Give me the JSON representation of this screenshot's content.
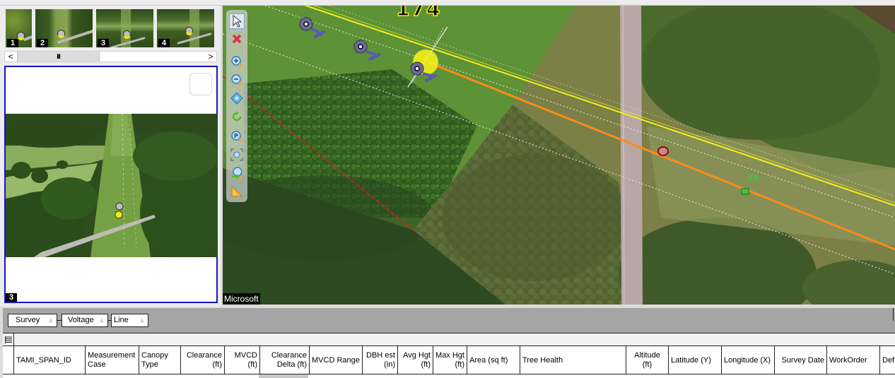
{
  "thumbnails": [
    {
      "label": "1"
    },
    {
      "label": "2"
    },
    {
      "label": "3"
    },
    {
      "label": "4"
    }
  ],
  "thumb_scroll": {
    "left_label": "<",
    "right_label": ">",
    "grip_label": "III"
  },
  "viewer": {
    "photo_number": "3"
  },
  "map": {
    "span_label": "174",
    "tree_label": "78",
    "attribution": "Microsoft",
    "colors": {
      "conductor": "#f4ee1c",
      "span_line": "#ff8a1a",
      "boundary": "#d8221a",
      "tree_marker": "#3ec93e"
    },
    "tools": [
      {
        "name": "select-tool"
      },
      {
        "name": "clear-selection-tool"
      },
      {
        "name": "zoom-in-tool"
      },
      {
        "name": "zoom-out-tool"
      },
      {
        "name": "pan-tool"
      },
      {
        "name": "refresh-tool"
      },
      {
        "name": "zoom-to-point-tool"
      },
      {
        "name": "zoom-extent-tool"
      },
      {
        "name": "zoom-previous-tool"
      },
      {
        "name": "measure-tool"
      }
    ]
  },
  "grid": {
    "group_chips": [
      {
        "label": "Survey",
        "sort": "▵"
      },
      {
        "label": "Voltage",
        "sort": "▵"
      },
      {
        "label": "Line",
        "sort": "▵"
      }
    ],
    "columns": [
      {
        "label": "TAMI_SPAN_ID"
      },
      {
        "label": "Measurement Case"
      },
      {
        "label": "Canopy Type"
      },
      {
        "label": "Clearance (ft)"
      },
      {
        "label": "MVCD (ft)"
      },
      {
        "label": "Clearance Delta (ft)"
      },
      {
        "label": "MVCD Range"
      },
      {
        "label": "DBH est (in)"
      },
      {
        "label": "Avg Hgt (ft)"
      },
      {
        "label": "Max Hgt (ft)"
      },
      {
        "label": "Area (sq ft)"
      },
      {
        "label": "Tree Health"
      },
      {
        "label": "Altitude (ft)"
      },
      {
        "label": "Latitude (Y)"
      },
      {
        "label": "Longitude (X)"
      },
      {
        "label": "Survey Date"
      },
      {
        "label": "WorkOrder"
      },
      {
        "label": "Def"
      }
    ]
  }
}
